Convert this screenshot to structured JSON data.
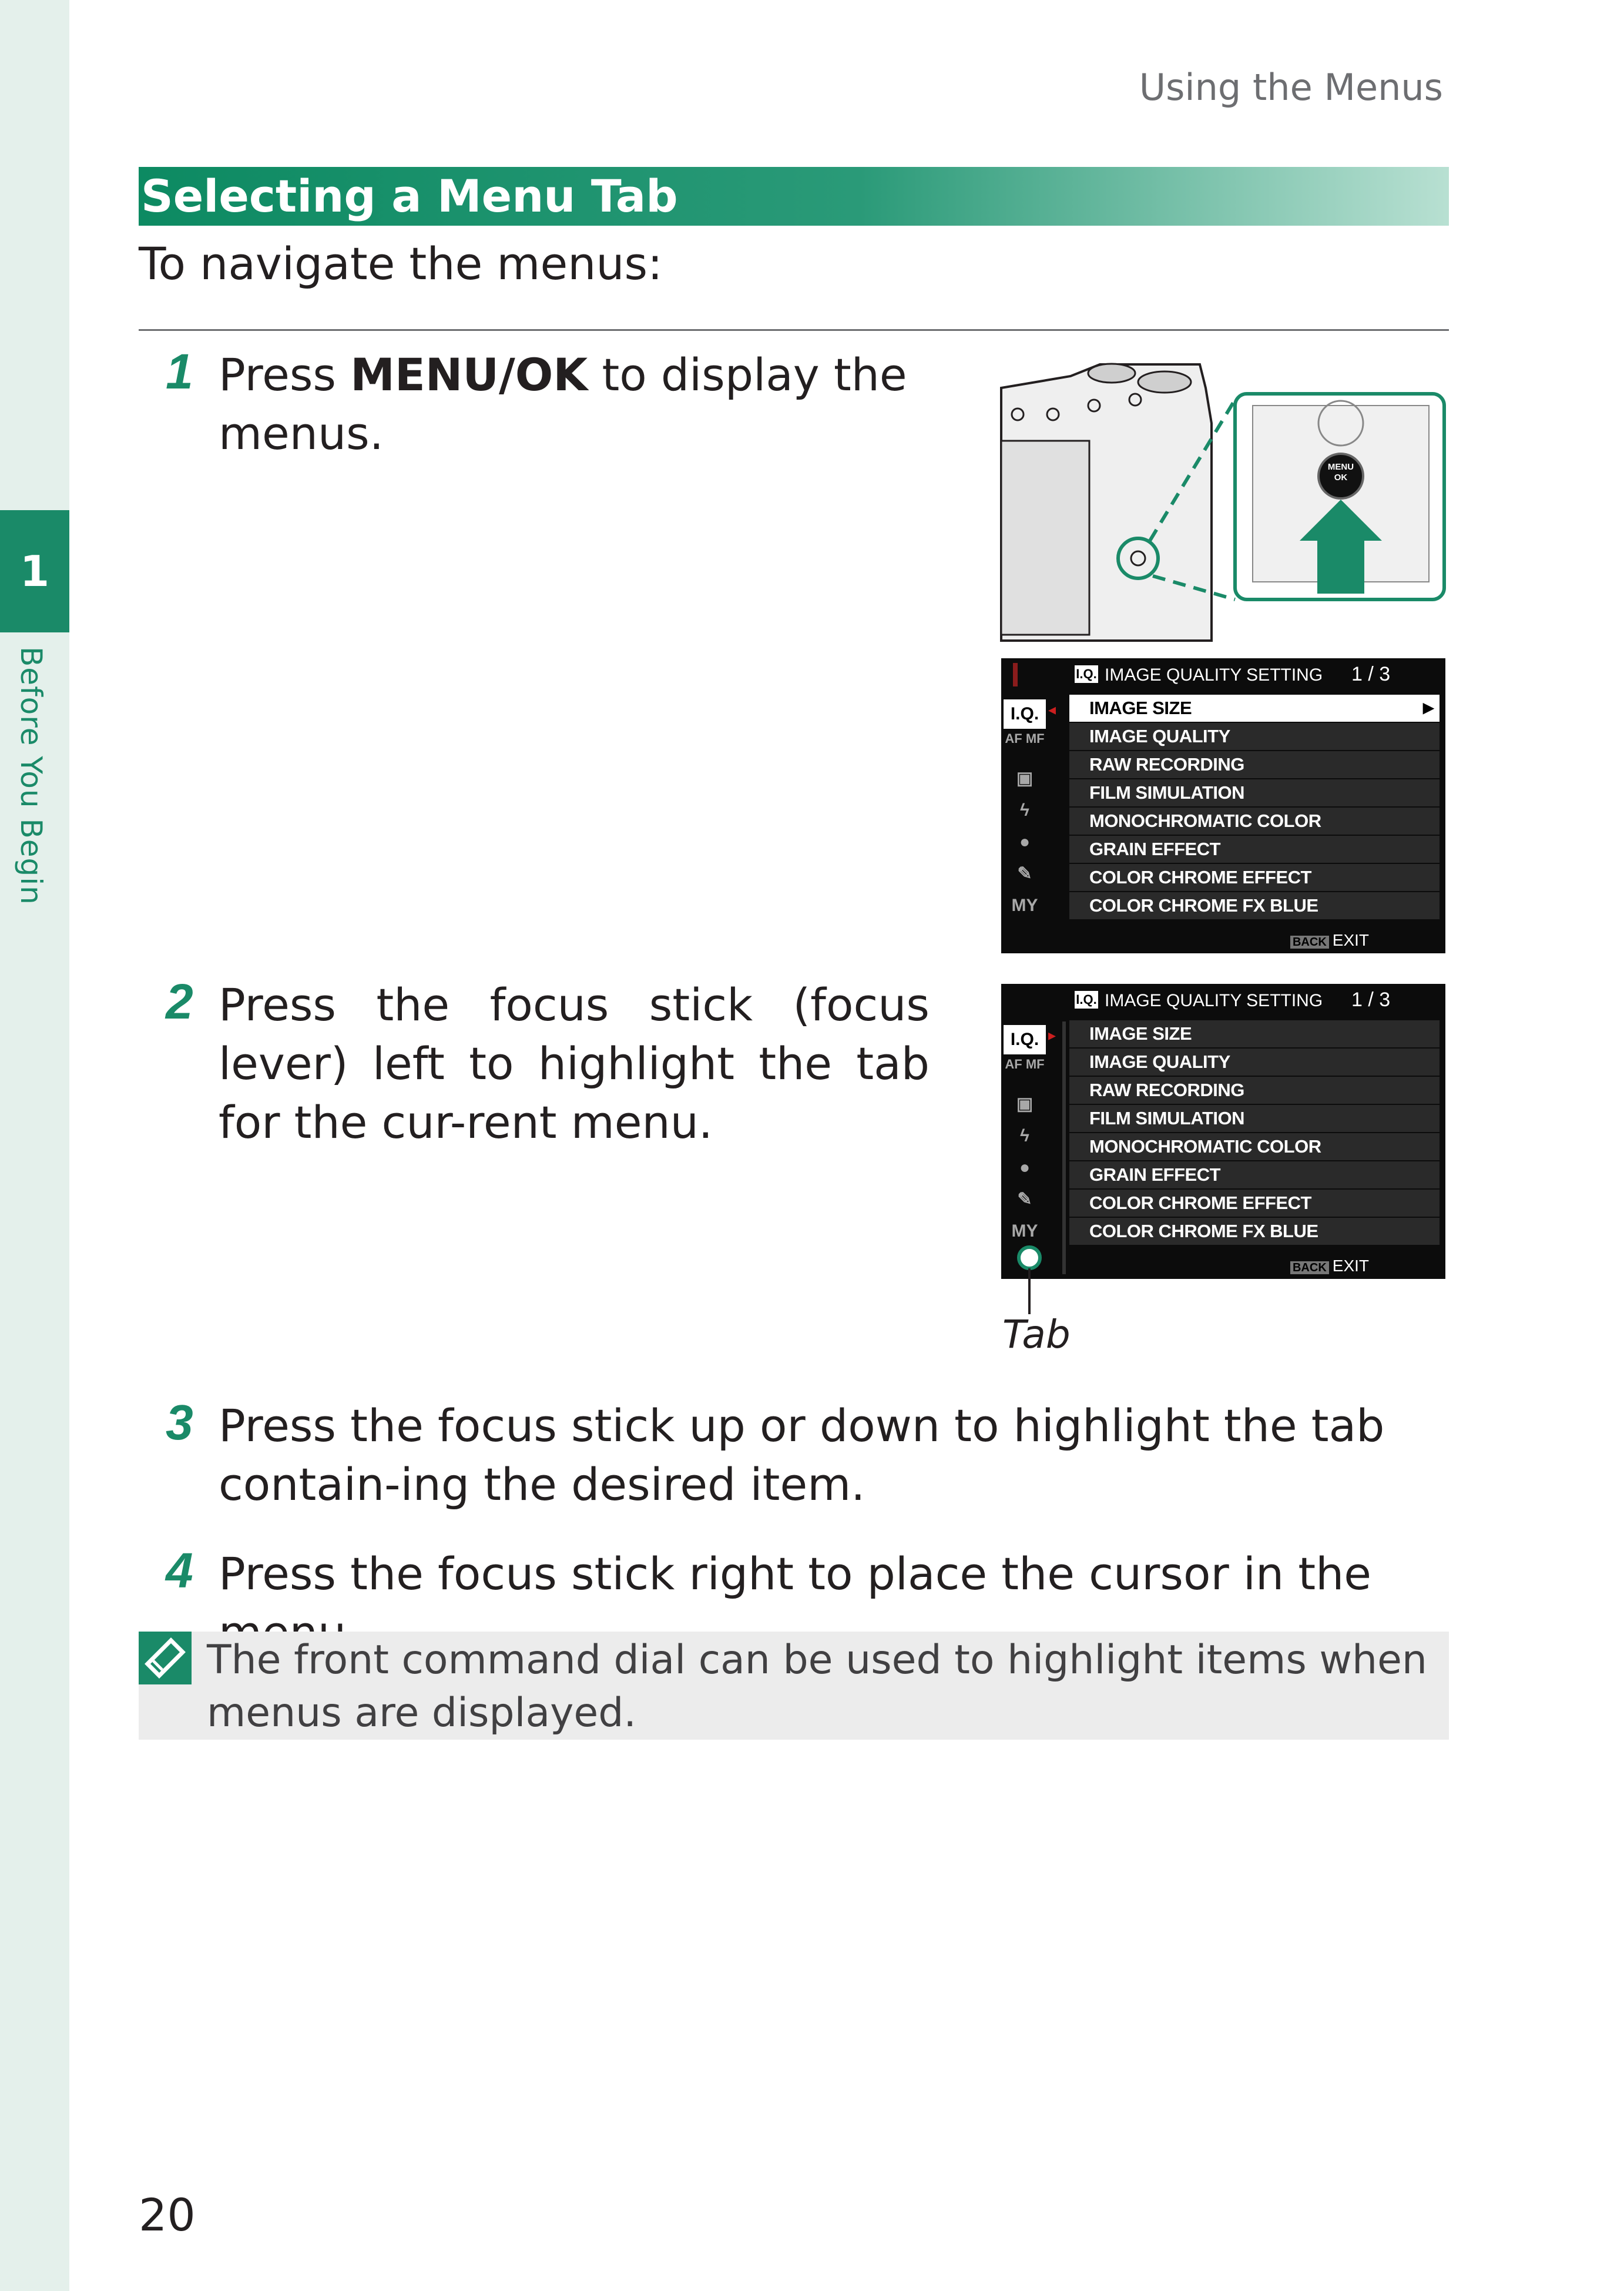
{
  "running_head": "Using the Menus",
  "chapter": {
    "number": "1",
    "label": "Before You Begin"
  },
  "section_title": "Selecting a Menu Tab",
  "intro": "To navigate the menus:",
  "steps": [
    {
      "number": "1",
      "text_before": "Press ",
      "text_bold": "MENU/OK",
      "text_after": " to display the menus."
    },
    {
      "number": "2",
      "text": "Press the focus stick (focus lever) left to highlight the tab for the cur-rent menu."
    },
    {
      "number": "3",
      "text": "Press the focus stick up or down to highlight the tab contain-ing the desired item."
    },
    {
      "number": "4",
      "text": "Press the focus stick right to place the cursor in the menu."
    }
  ],
  "camera_button_label": "MENU OK",
  "screen": {
    "title": "IMAGE QUALITY SETTING",
    "iq_badge": "I.Q.",
    "page": "1 / 3",
    "tabs": [
      "I.Q.",
      "AF MF",
      "camera",
      "flash",
      "movie",
      "setup",
      "MY"
    ],
    "items": [
      "IMAGE SIZE",
      "IMAGE QUALITY",
      "RAW RECORDING",
      "FILM SIMULATION",
      "MONOCHROMATIC COLOR",
      "GRAIN EFFECT",
      "COLOR CHROME EFFECT",
      "COLOR CHROME FX BLUE"
    ],
    "back_badge": "BACK",
    "exit_label": "EXIT"
  },
  "tab_caption": "Tab",
  "note": "The front command dial can be used to highlight items when menus are displayed.",
  "page_number": "20",
  "colors": {
    "accent": "#1a8a68",
    "strip": "#e4f0eb"
  }
}
